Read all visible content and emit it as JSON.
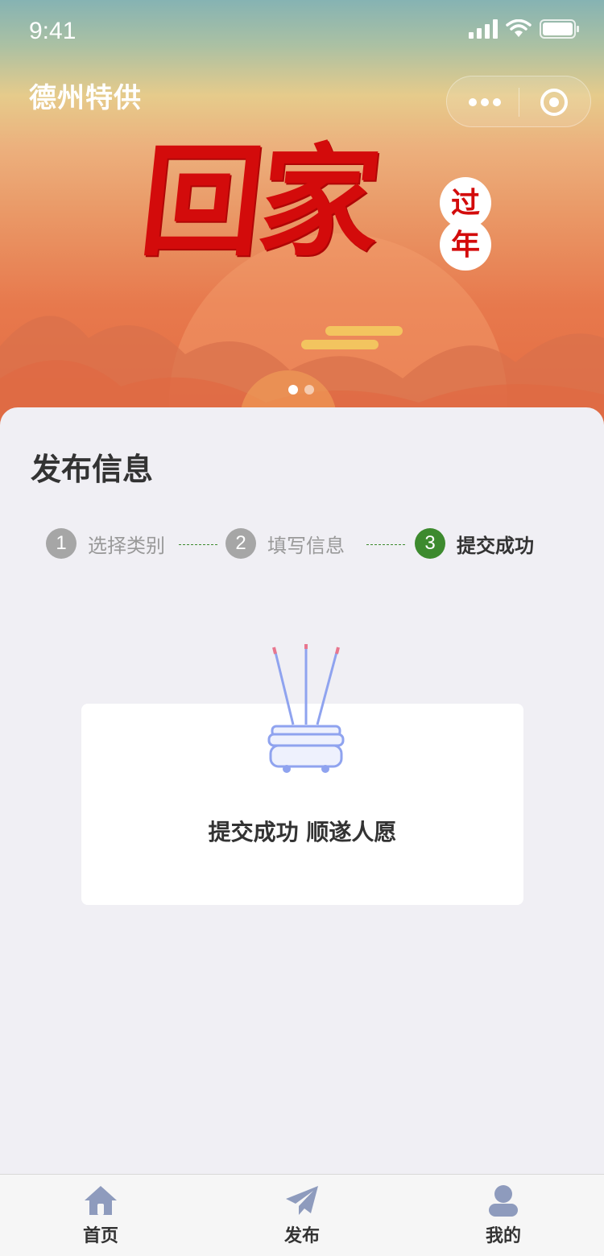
{
  "status_bar": {
    "time": "9:41"
  },
  "header": {
    "app_title": "德州特供"
  },
  "banner": {
    "art_title": "回家",
    "badge_chars": [
      "过",
      "年"
    ],
    "active_slide": 1,
    "slide_count": 2
  },
  "main": {
    "title": "发布信息",
    "steps": [
      {
        "number": "1",
        "label": "选择类别",
        "state": "done"
      },
      {
        "number": "2",
        "label": "填写信息",
        "state": "done"
      },
      {
        "number": "3",
        "label": "提交成功",
        "state": "active"
      }
    ],
    "result_message": "提交成功 顺遂人愿"
  },
  "tabbar": {
    "items": [
      {
        "label": "首页",
        "icon": "home-icon"
      },
      {
        "label": "发布",
        "icon": "paper-plane-icon"
      },
      {
        "label": "我的",
        "icon": "user-icon"
      }
    ]
  },
  "colors": {
    "step_active": "#3d8a2e",
    "step_inactive": "#a6a6a6",
    "banner_red": "#d30b0b",
    "incense_blue": "#8fa3ef",
    "tab_icon": "#8e9bbd"
  }
}
